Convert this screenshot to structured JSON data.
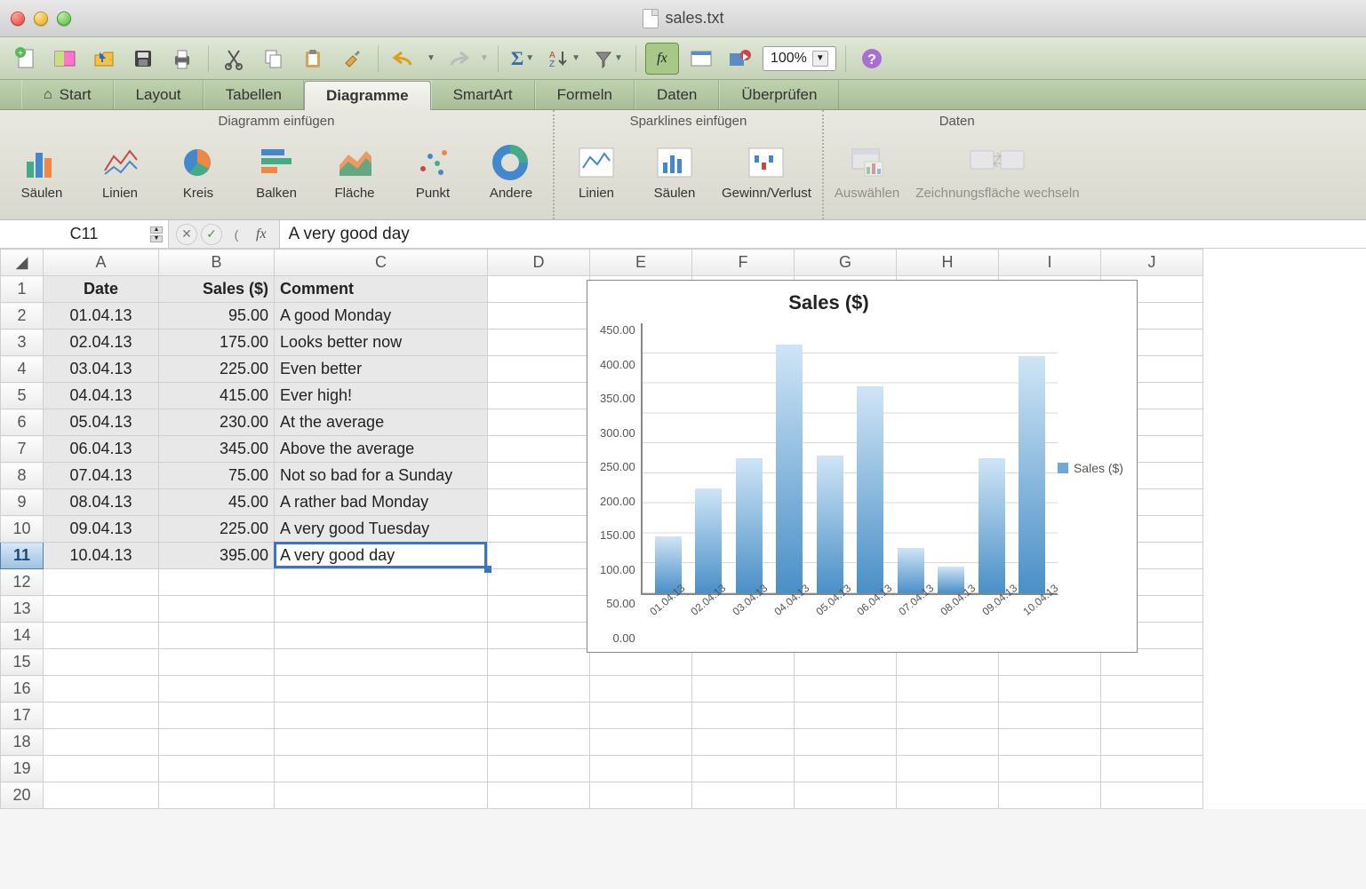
{
  "window": {
    "title": "sales.txt"
  },
  "zoom": "100%",
  "tabs": [
    {
      "label": "Start",
      "active": false,
      "home": true
    },
    {
      "label": "Layout",
      "active": false
    },
    {
      "label": "Tabellen",
      "active": false
    },
    {
      "label": "Diagramme",
      "active": true
    },
    {
      "label": "SmartArt",
      "active": false
    },
    {
      "label": "Formeln",
      "active": false
    },
    {
      "label": "Daten",
      "active": false
    },
    {
      "label": "Überprüfen",
      "active": false
    }
  ],
  "ribbon_groups": {
    "insert_chart": {
      "title": "Diagramm einfügen",
      "items": [
        "Säulen",
        "Linien",
        "Kreis",
        "Balken",
        "Fläche",
        "Punkt",
        "Andere"
      ]
    },
    "sparklines": {
      "title": "Sparklines einfügen",
      "items": [
        "Linien",
        "Säulen",
        "Gewinn/Verlust"
      ]
    },
    "data": {
      "title": "Daten",
      "items": [
        "Auswählen",
        "Zeichnungsfläche wechseln"
      ]
    }
  },
  "formula_bar": {
    "cell_ref": "C11",
    "fx_label": "fx",
    "content": "A very good day"
  },
  "columns": [
    "A",
    "B",
    "C",
    "D",
    "E",
    "F",
    "G",
    "H",
    "I",
    "J"
  ],
  "headers": {
    "date": "Date",
    "sales": "Sales ($)",
    "comment": "Comment"
  },
  "rows": [
    {
      "date": "01.04.13",
      "sales": "95.00",
      "comment": "A good Monday"
    },
    {
      "date": "02.04.13",
      "sales": "175.00",
      "comment": "Looks better now"
    },
    {
      "date": "03.04.13",
      "sales": "225.00",
      "comment": "Even better"
    },
    {
      "date": "04.04.13",
      "sales": "415.00",
      "comment": "Ever high!"
    },
    {
      "date": "05.04.13",
      "sales": "230.00",
      "comment": "At the average"
    },
    {
      "date": "06.04.13",
      "sales": "345.00",
      "comment": "Above the average"
    },
    {
      "date": "07.04.13",
      "sales": "75.00",
      "comment": "Not so bad for a Sunday"
    },
    {
      "date": "08.04.13",
      "sales": "45.00",
      "comment": "A rather bad Monday"
    },
    {
      "date": "09.04.13",
      "sales": "225.00",
      "comment": "A very good Tuesday"
    },
    {
      "date": "10.04.13",
      "sales": "395.00",
      "comment": "A very good day"
    }
  ],
  "extra_row_count": 9,
  "active_cell": {
    "row": 11,
    "col": "C"
  },
  "chart_data": {
    "type": "bar",
    "title": "Sales ($)",
    "categories": [
      "01.04.13",
      "02.04.13",
      "03.04.13",
      "04.04.13",
      "05.04.13",
      "06.04.13",
      "07.04.13",
      "08.04.13",
      "09.04.13",
      "10.04.13"
    ],
    "values": [
      95,
      175,
      225,
      415,
      230,
      345,
      75,
      45,
      225,
      395
    ],
    "series": [
      {
        "name": "Sales ($)",
        "values": [
          95,
          175,
          225,
          415,
          230,
          345,
          75,
          45,
          225,
          395
        ]
      }
    ],
    "legend": "Sales ($)",
    "ylabel": "",
    "xlabel": "",
    "ylim": [
      0,
      450
    ],
    "yticks": [
      "450.00",
      "400.00",
      "350.00",
      "300.00",
      "250.00",
      "200.00",
      "150.00",
      "100.00",
      "50.00",
      "0.00"
    ]
  }
}
